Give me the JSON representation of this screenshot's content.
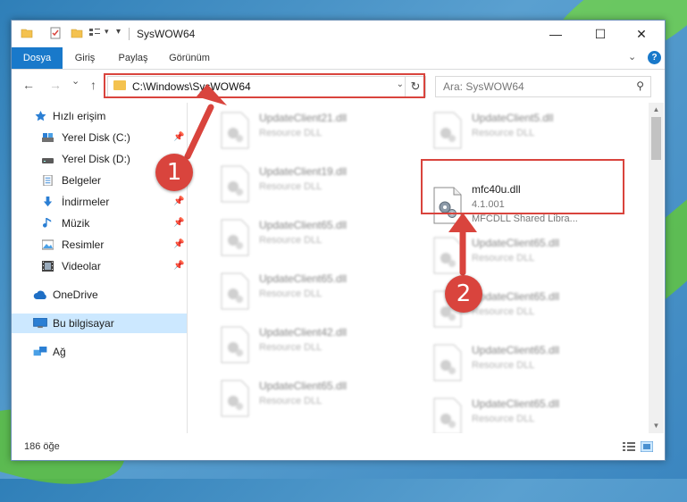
{
  "window": {
    "title": "SysWOW64",
    "controls": {
      "minimize": "—",
      "maximize": "☐",
      "close": "✕"
    }
  },
  "ribbon": {
    "tabs": [
      "Dosya",
      "Giriş",
      "Paylaş",
      "Görünüm"
    ],
    "expand_icon": "chevron-down-icon",
    "help": "?"
  },
  "nav": {
    "back": "←",
    "forward": "→",
    "recent": "⌄",
    "up": "↑"
  },
  "address": {
    "path": "C:\\Windows\\SysWOW64",
    "dropdown": "⌄",
    "refresh": "↻"
  },
  "search": {
    "placeholder": "Ara: SysWOW64",
    "icon": "⚲"
  },
  "sidebar": {
    "items": [
      {
        "label": "Hızlı erişim",
        "icon": "star-icon",
        "pinned": false
      },
      {
        "label": "Yerel Disk (C:)",
        "icon": "drive-icon",
        "pinned": true
      },
      {
        "label": "Yerel Disk (D:)",
        "icon": "drive-icon",
        "pinned": false
      },
      {
        "label": "Belgeler",
        "icon": "documents-icon",
        "pinned": true
      },
      {
        "label": "İndirmeler",
        "icon": "download-icon",
        "pinned": true
      },
      {
        "label": "Müzik",
        "icon": "music-icon",
        "pinned": true
      },
      {
        "label": "Resimler",
        "icon": "pictures-icon",
        "pinned": true
      },
      {
        "label": "Videolar",
        "icon": "videos-icon",
        "pinned": true
      },
      {
        "label": "OneDrive",
        "icon": "cloud-icon",
        "pinned": false
      },
      {
        "label": "Bu bilgisayar",
        "icon": "computer-icon",
        "pinned": false,
        "selected": true
      },
      {
        "label": "Ağ",
        "icon": "network-icon",
        "pinned": false
      }
    ],
    "pin_glyph": "📌"
  },
  "files": {
    "left_column": [
      {
        "name": "UpdateClient21.dll",
        "type": "Resource DLL"
      },
      {
        "name": "UpdateClient19.dll",
        "type": "Resource DLL"
      },
      {
        "name": "UpdateClient65.dll",
        "type": "Resource DLL"
      },
      {
        "name": "UpdateClient65.dll",
        "type": "Resource DLL"
      },
      {
        "name": "UpdateClient42.dll",
        "type": "Resource DLL"
      },
      {
        "name": "UpdateClient65.dll",
        "type": "Resource DLL"
      }
    ],
    "right_column": [
      {
        "name": "UpdateClient5.dll",
        "type": "Resource DLL"
      },
      {
        "name": "mfc40u.dll",
        "version": "4.1.001",
        "type": "MFCDLL Shared Libra...",
        "highlighted": true
      },
      {
        "name": "UpdateClient65.dll",
        "type": "Resource DLL"
      },
      {
        "name": "UpdateClient65.dll",
        "type": "Resource DLL"
      },
      {
        "name": "UpdateClient65.dll",
        "type": "Resource DLL"
      },
      {
        "name": "UpdateClient65.dll",
        "type": "Resource DLL"
      }
    ]
  },
  "status": {
    "count": "186 öğe"
  },
  "callouts": {
    "one": "1",
    "two": "2"
  },
  "colors": {
    "accent": "#1979ca",
    "highlight": "#d9443d",
    "selected_bg": "#cce8ff"
  }
}
